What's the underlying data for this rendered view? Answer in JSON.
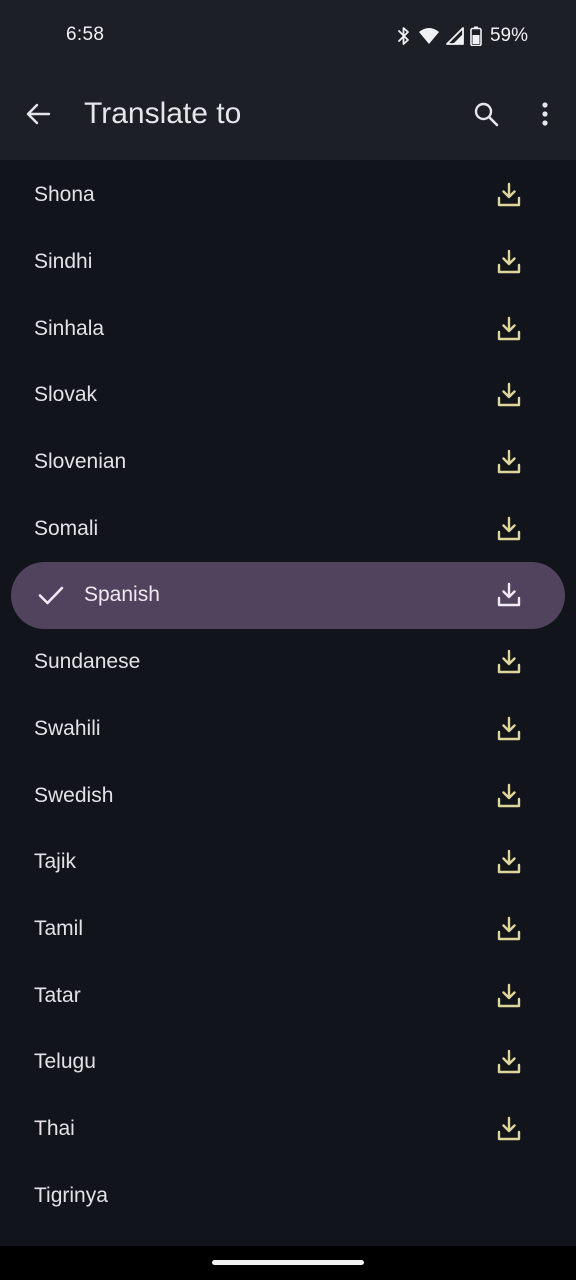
{
  "status_bar": {
    "time": "6:58",
    "battery": "59%",
    "icons": [
      "bluetooth-icon",
      "wifi-icon",
      "signal-icon",
      "battery-icon"
    ]
  },
  "app_bar": {
    "title": "Translate to",
    "icons": [
      "back-arrow-icon",
      "search-icon",
      "more-vert-icon"
    ]
  },
  "languages": [
    {
      "label": "Shona"
    },
    {
      "label": "Sindhi"
    },
    {
      "label": "Sinhala"
    },
    {
      "label": "Slovak"
    },
    {
      "label": "Slovenian"
    },
    {
      "label": "Somali"
    },
    {
      "label": "Spanish",
      "selected": true
    },
    {
      "label": "Sundanese"
    },
    {
      "label": "Swahili"
    },
    {
      "label": "Swedish"
    },
    {
      "label": "Tajik"
    },
    {
      "label": "Tamil"
    },
    {
      "label": "Tatar"
    },
    {
      "label": "Telugu"
    },
    {
      "label": "Thai"
    },
    {
      "label": "Tigrinya"
    }
  ],
  "colors": {
    "background": "#11141b",
    "app_bar": "#1c1f26",
    "selected_row": "#51435d",
    "download_icon": "#ddd59a",
    "selected_icon": "#f0eaf4"
  }
}
